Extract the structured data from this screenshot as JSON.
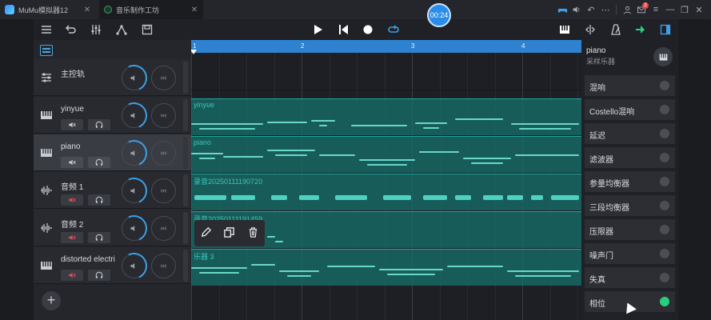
{
  "window": {
    "emulator_title": "MuMu模拟器12",
    "app_tab_title": "音乐制作工坊",
    "timer": "00:24",
    "notification_count": "2"
  },
  "toolbar": {
    "icons": [
      "menu-icon",
      "undo-icon",
      "mixer-icon",
      "node-icon",
      "save-icon",
      "play-icon",
      "rewind-icon",
      "record-icon",
      "loop-icon",
      "keyboard-icon",
      "split-icon",
      "metronome-icon",
      "export-arrow-icon",
      "panel-toggle-icon"
    ],
    "accent_color": "#3aa0e8",
    "export_color": "#26d07c"
  },
  "tracks": [
    {
      "name": "主控轨",
      "icon": "sliders-icon",
      "master": true
    },
    {
      "name": "yinyue",
      "icon": "piano-icon"
    },
    {
      "name": "piano",
      "icon": "piano-icon",
      "selected": true
    },
    {
      "name": "音频 1",
      "icon": "waveform-icon"
    },
    {
      "name": "音频 2",
      "icon": "waveform-icon"
    },
    {
      "name": "distorted  electri",
      "icon": "piano-icon"
    }
  ],
  "timeline": {
    "bars": [
      "1",
      "2",
      "3",
      "4"
    ],
    "clips": [
      {
        "name": "yinyue",
        "kind": "midi"
      },
      {
        "name": "piano",
        "kind": "midi"
      },
      {
        "name": "录音20250111190720",
        "kind": "audio"
      },
      {
        "name": "录音20250111191459",
        "kind": "audio"
      },
      {
        "name": "乐器 3",
        "kind": "midi"
      }
    ],
    "clip_color": "#176e69"
  },
  "fx_panel": {
    "title": "piano",
    "subtitle": "采样乐器",
    "effects": [
      {
        "label": "混响",
        "enabled": false
      },
      {
        "label": "Costello混响",
        "enabled": false
      },
      {
        "label": "延迟",
        "enabled": false
      },
      {
        "label": "滤波器",
        "enabled": false
      },
      {
        "label": "参量均衡器",
        "enabled": false
      },
      {
        "label": "三段均衡器",
        "enabled": false
      },
      {
        "label": "压限器",
        "enabled": false
      },
      {
        "label": "噪声门",
        "enabled": false
      },
      {
        "label": "失真",
        "enabled": false
      },
      {
        "label": "相位",
        "enabled": true
      }
    ],
    "enabled_color": "#26d07c"
  }
}
